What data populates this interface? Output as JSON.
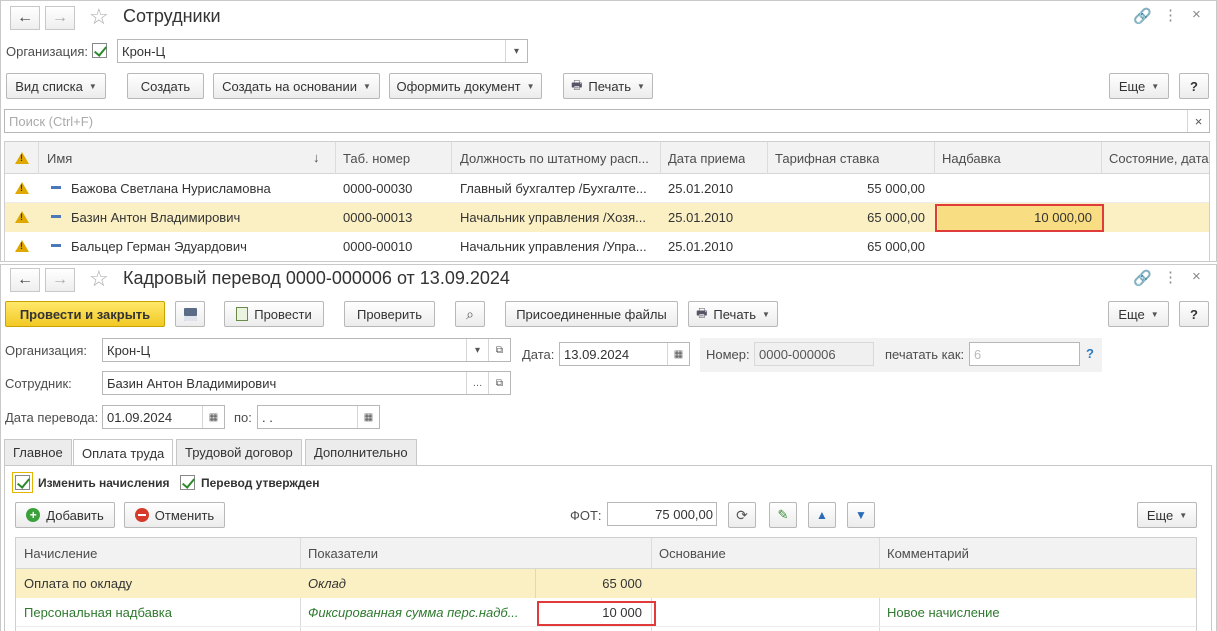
{
  "list_window": {
    "title": "Сотрудники",
    "org_label": "Организация:",
    "org_value": "Крон-Ц",
    "toolbar": {
      "list_view": "Вид списка",
      "create": "Создать",
      "create_based": "Создать на основании",
      "make_document": "Оформить документ",
      "print": "Печать",
      "more": "Еще",
      "help": "?"
    },
    "search_placeholder": "Поиск (Ctrl+F)",
    "columns": [
      "Имя",
      "Таб. номер",
      "Должность по штатному расп...",
      "Дата приема",
      "Тарифная ставка",
      "Надбавка",
      "Состояние, дата"
    ],
    "sort_arrow": "↓",
    "rows": [
      {
        "name": "Бажова Светлана Нурисламовна",
        "tab": "0000-00030",
        "position": "Главный бухгалтер /Бухгалте...",
        "date": "25.01.2010",
        "rate": "55 000,00",
        "bonus": ""
      },
      {
        "name": "Базин Антон Владимирович",
        "tab": "0000-00013",
        "position": "Начальник управления /Хозя...",
        "date": "25.01.2010",
        "rate": "65 000,00",
        "bonus": "10 000,00"
      },
      {
        "name": "Бальцер Герман Эдуардович",
        "tab": "0000-00010",
        "position": "Начальник управления /Упра...",
        "date": "25.01.2010",
        "rate": "65 000,00",
        "bonus": ""
      }
    ]
  },
  "doc_window": {
    "title": "Кадровый перевод 0000-000006 от 13.09.2024",
    "toolbar": {
      "post_close": "Провести и закрыть",
      "post": "Провести",
      "check": "Проверить",
      "attached": "Присоединенные файлы",
      "print": "Печать",
      "more": "Еще",
      "help": "?"
    },
    "org_label": "Организация:",
    "org_value": "Крон-Ц",
    "date_label": "Дата:",
    "date_value": "13.09.2024",
    "number_label": "Номер:",
    "number_value": "0000-000006",
    "print_as_label": "печатать как:",
    "print_as_placeholder": "6",
    "print_as_help": "?",
    "employee_label": "Сотрудник:",
    "employee_value": "Базин Антон Владимирович",
    "transfer_date_label": "Дата перевода:",
    "transfer_date_value": "01.09.2024",
    "to_label": "по:",
    "to_value": " .  .",
    "tabs": [
      "Главное",
      "Оплата труда",
      "Трудовой договор",
      "Дополнительно"
    ],
    "change_accruals": "Изменить начисления",
    "transfer_approved": "Перевод утвержден",
    "add": "Добавить",
    "cancel": "Отменить",
    "fot_label": "ФОТ:",
    "fot_value": "75 000,00",
    "more": "Еще",
    "columns": [
      "Начисление",
      "Показатели",
      "Основание",
      "Комментарий"
    ],
    "rows": [
      {
        "accrual": "Оплата по окладу",
        "indicator": "Оклад",
        "value": "65 000",
        "comment": ""
      },
      {
        "accrual": "Персональная надбавка",
        "indicator": "Фиксированная сумма перс.надб...",
        "value": "10 000",
        "comment": "Новое начисление"
      }
    ]
  }
}
